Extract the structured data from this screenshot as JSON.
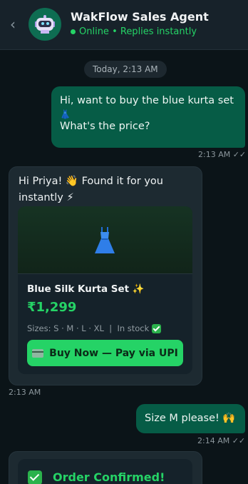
{
  "header": {
    "back_glyph": "‹",
    "title": "WakFlow Sales Agent",
    "status": "Online • Replies instantly",
    "avatar_icon": "robot-icon"
  },
  "date_divider": "Today, 2:13 AM",
  "messages": [
    {
      "direction": "outgoing",
      "line1": "Hi, want to buy the blue kurta set",
      "emoji": "👗",
      "line2": "What's the price?",
      "time": "2:13 AM",
      "ticks": "✓✓"
    },
    {
      "direction": "incoming",
      "line1": "Hi Priya! 👋 Found it for you",
      "line2": "instantly ⚡",
      "time": "2:13 AM",
      "product": {
        "image_icon": "dress-icon",
        "title": "Blue Silk Kurta Set ✨",
        "price": "₹1,299",
        "meta": "Sizes: S · M · L · XL  |  In stock",
        "button": "Buy Now — Pay via UPI"
      }
    },
    {
      "direction": "outgoing",
      "text": "Size M please! 🙌",
      "time": "2:14 AM",
      "ticks": "✓✓"
    },
    {
      "direction": "incoming",
      "order_title": "Order Confirmed!"
    }
  ],
  "colors": {
    "accent": "#25d366",
    "outgoing_bubble": "#065c46",
    "incoming_bubble": "#1d2a31",
    "background": "#0b1418"
  }
}
